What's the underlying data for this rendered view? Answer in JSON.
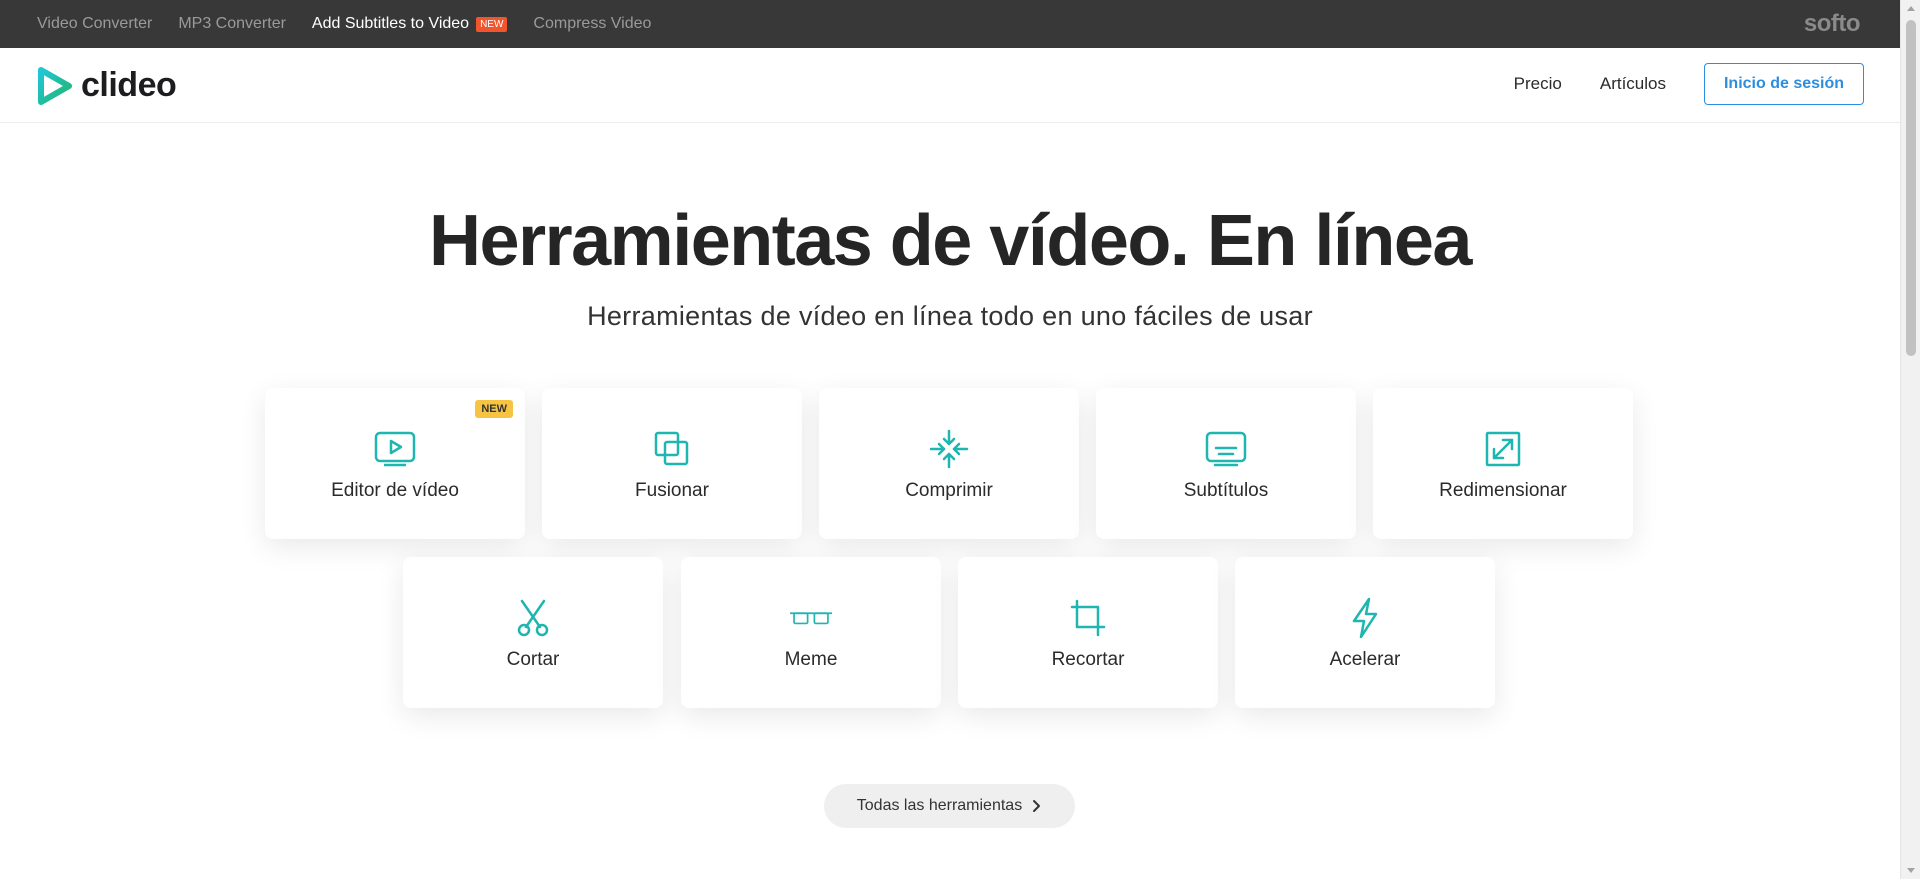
{
  "topbar": {
    "links": [
      "Video Converter",
      "MP3 Converter",
      "Add Subtitles to Video",
      "Compress Video"
    ],
    "new_badge": "NEW",
    "brand": "softo"
  },
  "header": {
    "logo_text": "clideo",
    "nav": [
      "Precio",
      "Artículos"
    ],
    "login_label": "Inicio de sesión"
  },
  "hero": {
    "title": "Herramientas de vídeo. En línea",
    "subtitle": "Herramientas de vídeo en línea todo en uno fáciles de usar"
  },
  "tools": [
    {
      "label": "Editor de vídeo",
      "icon": "play-screen-icon",
      "badge": "NEW"
    },
    {
      "label": "Fusionar",
      "icon": "merge-icon"
    },
    {
      "label": "Comprimir",
      "icon": "compress-icon"
    },
    {
      "label": "Subtítulos",
      "icon": "subtitles-icon"
    },
    {
      "label": "Redimensionar",
      "icon": "resize-icon"
    },
    {
      "label": "Cortar",
      "icon": "scissors-icon"
    },
    {
      "label": "Meme",
      "icon": "glasses-icon"
    },
    {
      "label": "Recortar",
      "icon": "crop-icon"
    },
    {
      "label": "Acelerar",
      "icon": "lightning-icon"
    }
  ],
  "all_tools_label": "Todas las herramientas",
  "colors": {
    "accent": "#2d8ddf",
    "icon_teal": "#1fb5b0",
    "topbar": "#383838",
    "new_orange": "#f0552e",
    "new_yellow": "#f6c343"
  }
}
